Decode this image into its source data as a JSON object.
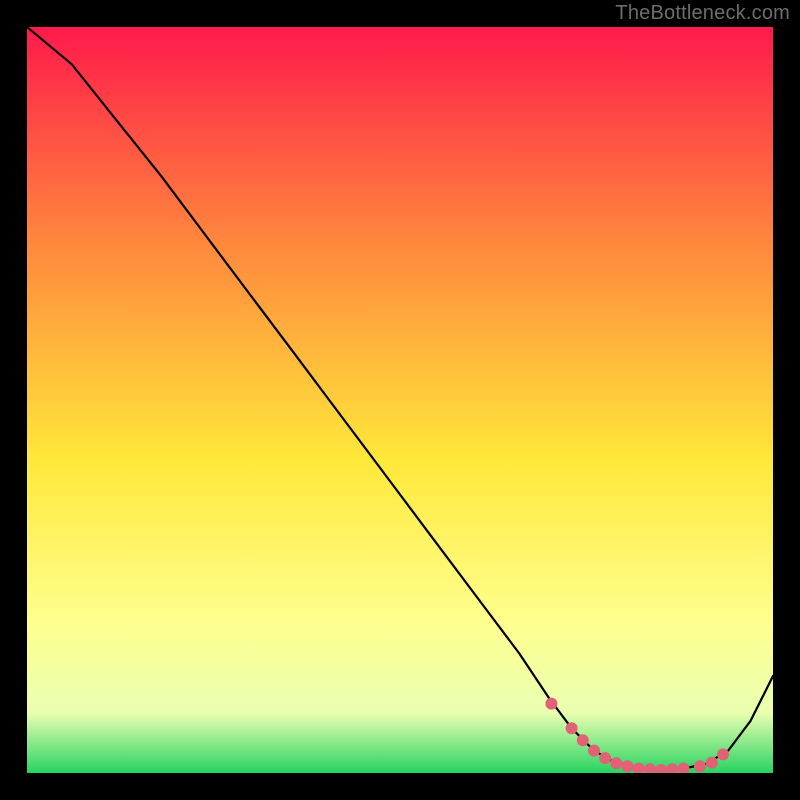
{
  "watermark": "TheBottleneck.com",
  "colors": {
    "frame": "#000000",
    "line": "#000000",
    "marker": "#e16176",
    "grad_top": "#ff1a4b",
    "grad_mid1": "#ff843d",
    "grad_mid2": "#ffe83a",
    "grad_mid3": "#feff8f",
    "grad_mid4": "#e9ffb0",
    "grad_bot": "#27d362"
  },
  "chart_data": {
    "type": "line",
    "title": "",
    "xlabel": "",
    "ylabel": "",
    "xlim": [
      0,
      100
    ],
    "ylim": [
      0,
      100
    ],
    "x": [
      0,
      6,
      12,
      18,
      24,
      30,
      36,
      42,
      48,
      54,
      60,
      66,
      70,
      73,
      76,
      79,
      82,
      85,
      88,
      91,
      94,
      97,
      100
    ],
    "y": [
      100,
      95,
      87.5,
      80,
      72,
      64,
      56,
      48,
      40,
      32,
      24,
      16,
      10,
      6,
      3,
      1.3,
      0.6,
      0.4,
      0.6,
      1.2,
      3,
      7,
      13
    ],
    "markers_x": [
      70.3,
      73,
      74.5,
      76,
      77.5,
      79,
      80.5,
      82,
      83.5,
      85,
      86.5,
      88,
      90.2,
      91.8,
      93.3
    ],
    "markers_y": [
      9.3,
      6.0,
      4.4,
      3.0,
      2.0,
      1.3,
      0.9,
      0.6,
      0.5,
      0.4,
      0.5,
      0.6,
      0.9,
      1.4,
      2.5
    ]
  }
}
